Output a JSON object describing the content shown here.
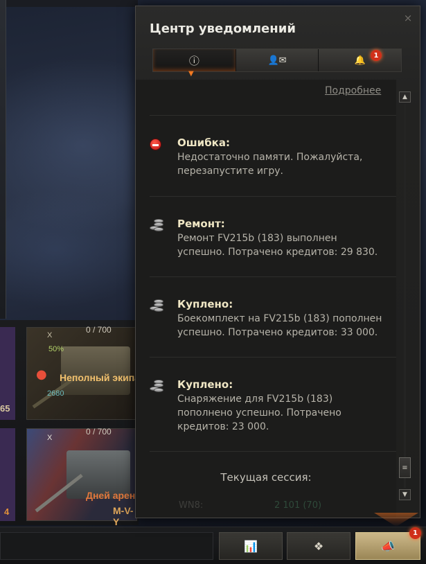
{
  "panel": {
    "title": "Центр уведомлений",
    "close_icon": "×",
    "tabs": [
      {
        "name": "info-icon",
        "glyph": "ⓘ"
      },
      {
        "name": "contacts-mail-icon",
        "glyph": "👤✉"
      },
      {
        "name": "bell-icon",
        "glyph": "🔔",
        "badge": "1"
      }
    ],
    "more_link": "Подробнее",
    "notifications": [
      {
        "type": "error",
        "title": "Ошибка:",
        "body": "Недостаточно памяти. Пожалуйста, перезапустите игру."
      },
      {
        "type": "credits",
        "title": "Ремонт:",
        "body": "Ремонт FV215b (183) выполнен успешно. Потрачено кредитов: 29 830."
      },
      {
        "type": "credits",
        "title": "Куплено:",
        "body": "Боекомплект на FV215b (183) пополнен успешно. Потрачено кредитов: 33 000."
      },
      {
        "type": "credits",
        "title": "Куплено:",
        "body": "Снаряжение для FV215b (183) пополнено успешно. Потрачено кредитов: 23 000."
      }
    ],
    "session_label": "Текущая сессия:",
    "session_faded_label": "WN8:",
    "session_faded_value": "2 101 (70)"
  },
  "carousel": {
    "cards": [
      {
        "count": "0 / 700",
        "tier": "X",
        "percent": "50%",
        "crew_warning": "Неполный экипаж",
        "experience": "2680",
        "side_number": "65"
      },
      {
        "count": "0 / 700",
        "tier": "X",
        "event_text": "Дней аренды",
        "tank_name": "M-V-Y",
        "side_number": "4"
      }
    ]
  },
  "bottom_bar": {
    "stats_icon": "📊",
    "hub_icon": "❖",
    "notifications_icon": "📣",
    "notifications_badge": "1"
  },
  "colors": {
    "accent": "#f27a22",
    "badge": "#d1301a",
    "title_text": "#efe6c4",
    "body_text": "#b7b4aa"
  }
}
